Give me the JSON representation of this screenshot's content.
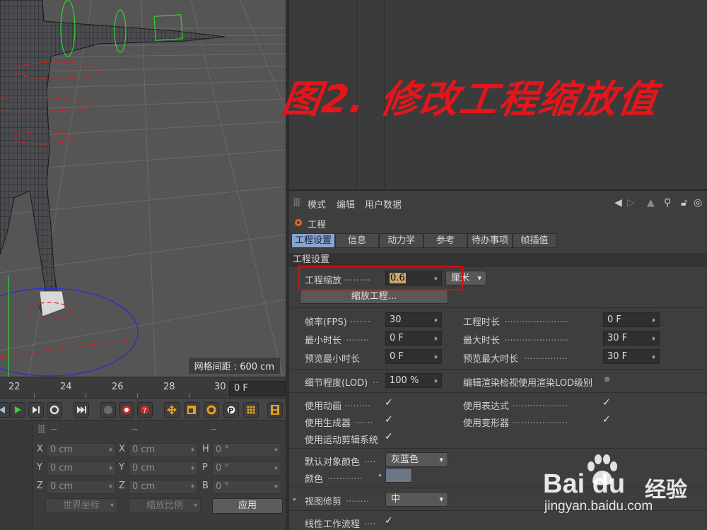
{
  "viewport": {
    "grid_readout": "网格间距 : 600 cm"
  },
  "timeline": {
    "ticks": [
      "22",
      "24",
      "26",
      "28",
      "30"
    ],
    "current_frame": "0 F"
  },
  "coords": {
    "col_heads": [
      "--",
      "--",
      "--"
    ],
    "axes_left": [
      "X",
      "Y",
      "Z"
    ],
    "axes_mid": [
      "X",
      "Y",
      "Z"
    ],
    "axes_right": [
      "H",
      "P",
      "B"
    ],
    "pos_values": [
      "0 cm",
      "0 cm",
      "0 cm"
    ],
    "size_values": [
      "0 cm",
      "0 cm",
      "0 cm"
    ],
    "rot_values": [
      "0 °",
      "0 °",
      "0 °"
    ],
    "coord_system": "世界坐标",
    "scale_mode": "缩放比例",
    "apply_label": "应用"
  },
  "caption": "图2. 修改工程缩放值",
  "attr": {
    "menu": [
      "模式",
      "编辑",
      "用户数据"
    ],
    "object_title": "工程",
    "tabs": [
      "工程设置",
      "信息",
      "动力学",
      "参考",
      "待办事项",
      "帧插值"
    ],
    "active_tab": 0,
    "section": "工程设置",
    "scale_label": "工程缩放",
    "scale_value": "0.6",
    "scale_unit": "厘米",
    "scale_project_btn": "缩放工程...",
    "fps_label": "帧率(FPS)",
    "fps_value": "30",
    "duration_label": "工程时长",
    "duration_value": "0 F",
    "min_time_label": "最小时长",
    "min_time_value": "0 F",
    "max_time_label": "最大时长",
    "max_time_value": "30 F",
    "prev_min_label": "预览最小时长",
    "prev_min_value": "0 F",
    "prev_max_label": "预览最大时长",
    "prev_max_value": "30 F",
    "lod_label": "细节程度(LOD)",
    "lod_value": "100 %",
    "render_lod_label": "编辑渲染检视使用渲染LOD级别",
    "use_anim_label": "使用动画",
    "use_expr_label": "使用表达式",
    "use_gen_label": "使用生成器",
    "use_deform_label": "使用变形器",
    "use_motion_label": "使用运动剪辑系统",
    "default_color_label": "默认对象颜色",
    "default_color_value": "灰蓝色",
    "color_label": "颜色",
    "view_clip_label": "视图修剪",
    "view_clip_value": "中",
    "linear_wf_label": "线性工作流程",
    "check": "✓",
    "swatch_color": "#6c7687"
  },
  "watermark": {
    "brand": "Bai du",
    "brand_cn": "经验",
    "url": "jingyan.baidu.com"
  }
}
